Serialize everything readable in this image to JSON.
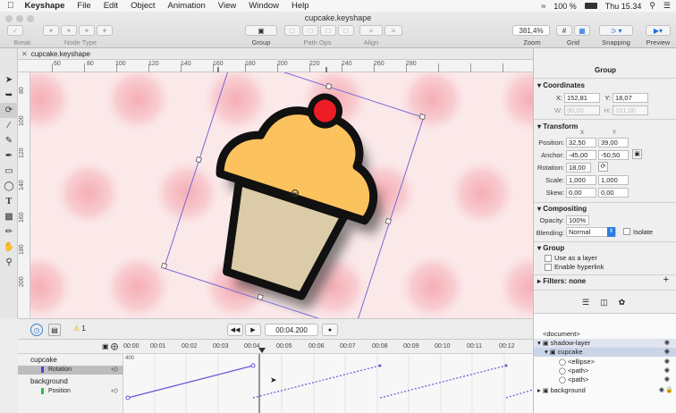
{
  "menubar": {
    "apple": "",
    "app": "Keyshape",
    "items": [
      "File",
      "Edit",
      "Object",
      "Animation",
      "View",
      "Window",
      "Help"
    ],
    "battery": "100 %",
    "clock": "Thu 15.34"
  },
  "window": {
    "title": "cupcake.keyshape"
  },
  "toolbar": {
    "break_nodes": "Break Nodes",
    "node_type": "Node Type",
    "group": "Group",
    "path_ops": "Path Ops",
    "align": "Align",
    "zoom_value": "381,4%",
    "zoom": "Zoom",
    "grid": "Grid",
    "snapping": "Snapping",
    "preview": "Preview"
  },
  "doc_tab": {
    "name": "cupcake.keyshape"
  },
  "ruler": {
    "h": [
      "60",
      "80",
      "100",
      "120",
      "140",
      "160",
      "180",
      "200",
      "220",
      "240",
      "260",
      "280"
    ],
    "v": [
      "80",
      "100",
      "120",
      "140",
      "160",
      "180",
      "200"
    ]
  },
  "canvas_bar": {
    "time": "00:04.200",
    "warnings": "1"
  },
  "timeline": {
    "ticks": [
      "00:00",
      "00:01",
      "00:02",
      "00:03",
      "00:04",
      "00:05",
      "00:06",
      "00:07",
      "00:08",
      "00:09",
      "00:10",
      "00:11",
      "00:12"
    ],
    "rows": [
      {
        "name": "cupcake",
        "prop": "Rotation",
        "color": "#5b3fd6"
      },
      {
        "name": "background",
        "prop": "Position",
        "color": "#2fbf4a"
      }
    ],
    "small_label": "400"
  },
  "inspector": {
    "header": "Group",
    "coordinates": {
      "title": "Coordinates",
      "x_label": "X:",
      "x": "152,81",
      "y_label": "Y:",
      "y": "18,07",
      "w_label": "W:",
      "w": "90,00",
      "h_label": "H:",
      "h": "101,00"
    },
    "transform": {
      "title": "Transform",
      "col_x": "X",
      "col_y": "Y",
      "position_label": "Position:",
      "position_x": "32,50",
      "position_y": "39,00",
      "anchor_label": "Anchor:",
      "anchor_x": "-45,00",
      "anchor_y": "-50,50",
      "rotation_label": "Rotation:",
      "rotation": "18,00",
      "scale_label": "Scale:",
      "scale_x": "1,000",
      "scale_y": "1,000",
      "skew_label": "Skew:",
      "skew_x": "0,00",
      "skew_y": "0,00"
    },
    "compositing": {
      "title": "Compositing",
      "opacity_label": "Opacity:",
      "opacity": "100%",
      "blending_label": "Blending:",
      "blending": "Normal",
      "isolate": "Isolate"
    },
    "group": {
      "title": "Group",
      "use_as_layer": "Use as a layer",
      "enable_hyperlink": "Enable hyperlink"
    },
    "filters": {
      "title": "Filters: none",
      "add": "+"
    }
  },
  "layers": [
    {
      "label": "<document>",
      "indent": 0
    },
    {
      "label": "shadow-layer",
      "indent": 1
    },
    {
      "label": "cupcake",
      "indent": 2
    },
    {
      "label": "<ellipse>",
      "indent": 3
    },
    {
      "label": "<path>",
      "indent": 3
    },
    {
      "label": "<path>",
      "indent": 3
    },
    {
      "label": "background",
      "indent": 1
    }
  ]
}
